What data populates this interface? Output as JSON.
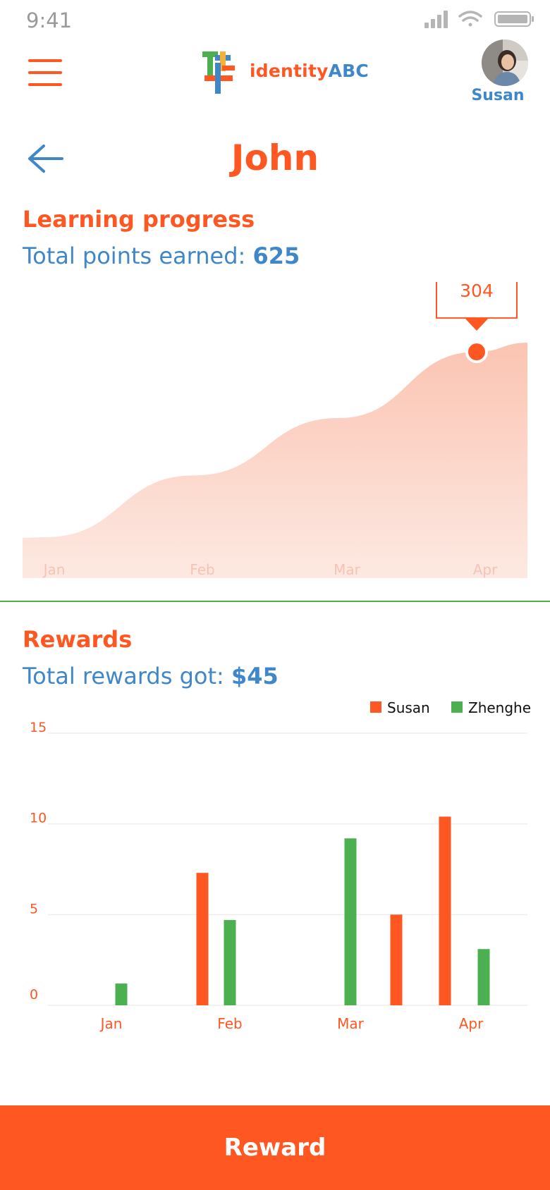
{
  "status_bar": {
    "time": "9:41"
  },
  "header": {
    "logo_text": "identity",
    "logo_text_accent": "ABC",
    "user_name": "Susan"
  },
  "page": {
    "title": "John"
  },
  "progress": {
    "title": "Learning progress",
    "subtitle_label": "Total points earned: ",
    "subtitle_value": "625"
  },
  "rewards": {
    "title": "Rewards",
    "subtitle_label": "Total rewards got: ",
    "subtitle_value": "$45"
  },
  "footer": {
    "button_label": "Reward"
  },
  "colors": {
    "accent": "#ff5722",
    "blue": "#3f87c9",
    "green": "#4caf50"
  },
  "chart_data": [
    {
      "type": "area",
      "categories": [
        "Jan",
        "Feb",
        "Mar",
        "Apr"
      ],
      "callout": "304",
      "series": [
        {
          "values": [
            55,
            138,
            215,
            304
          ]
        }
      ],
      "ylim": [
        0,
        360
      ]
    },
    {
      "type": "bar",
      "categories": [
        "Jan",
        "Feb",
        "Mar",
        "Apr"
      ],
      "yticks": [
        "0",
        "5",
        "10",
        "15"
      ],
      "ylim": [
        0,
        15
      ],
      "legend_position": "top-right",
      "series": [
        {
          "name": "Susan",
          "color": "#ff5722",
          "values": [
            0,
            7.3,
            5.0,
            10.4
          ]
        },
        {
          "name": "Zhenghe",
          "color": "#4caf50",
          "values": [
            1.2,
            4.7,
            9.2,
            3.1
          ]
        }
      ]
    }
  ]
}
